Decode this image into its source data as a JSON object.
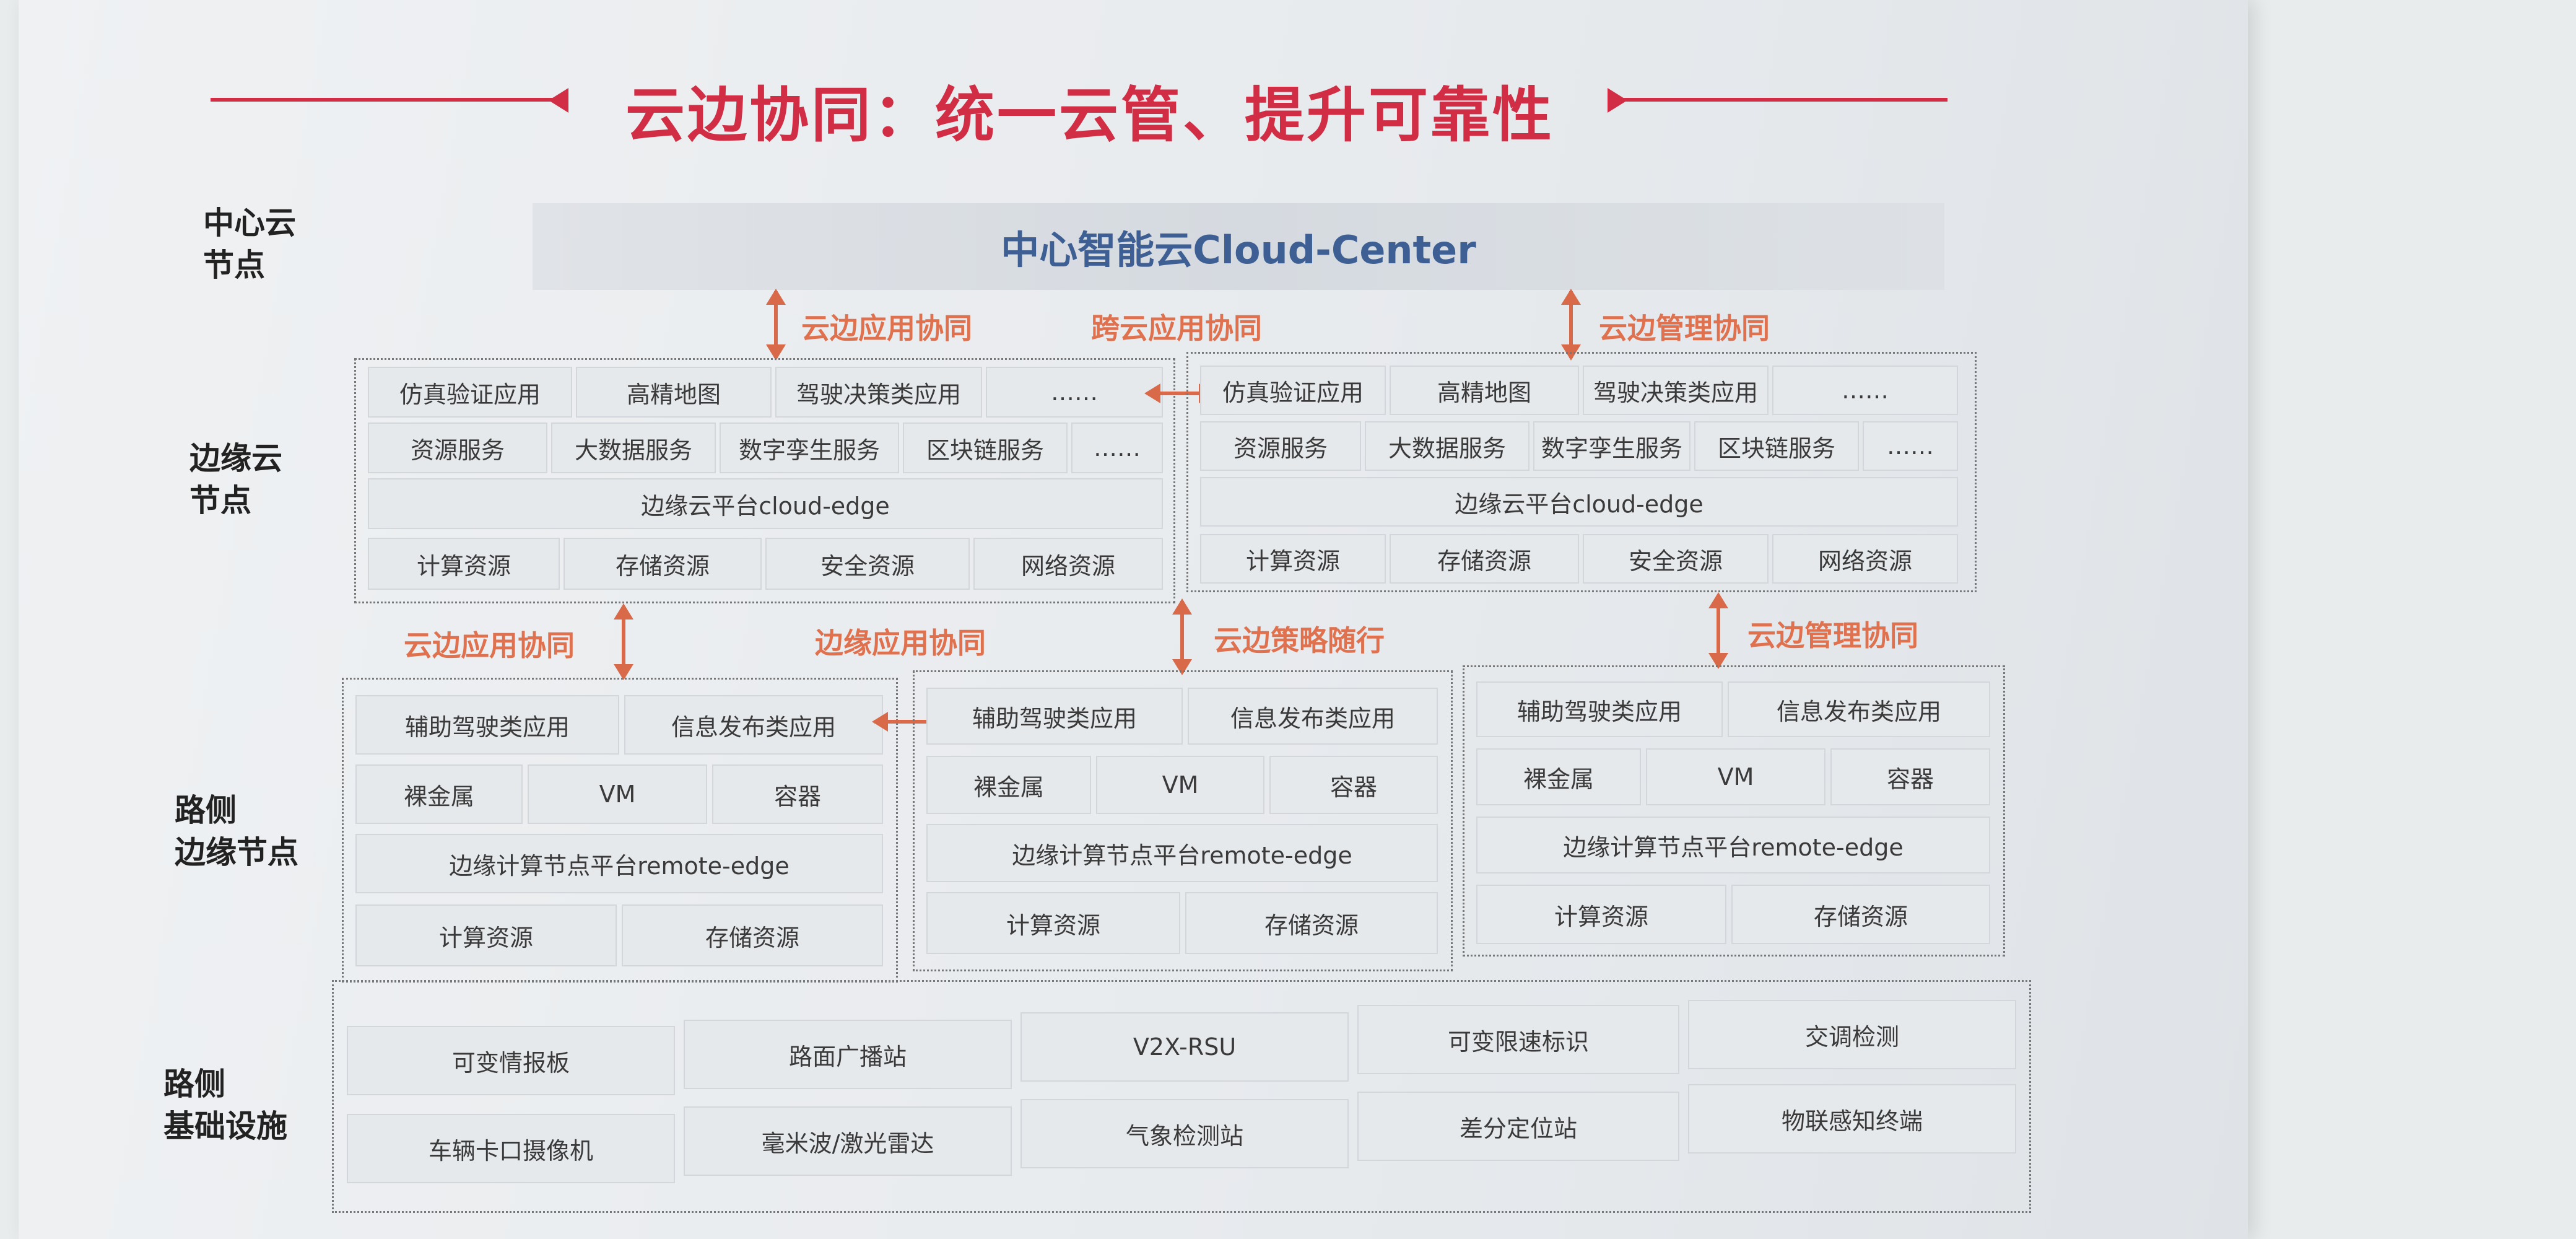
{
  "title": "云边协同：统一云管、提升可靠性",
  "labels": {
    "center": [
      "中心云",
      "节点"
    ],
    "edge_cloud": [
      "边缘云",
      "节点"
    ],
    "roadside_edge": [
      "路侧",
      "边缘节点"
    ],
    "roadside_infra": [
      "路侧",
      "基础设施"
    ]
  },
  "center_cloud": "中心智能云Cloud-Center",
  "arrow_labels": {
    "top_left": "云边应用协同",
    "top_mid": "跨云应用协同",
    "top_right": "云边管理协同",
    "mid_left": "云边应用协同",
    "mid_center": "边缘应用协同",
    "mid_mid": "云边策略随行",
    "mid_right": "云边管理协同"
  },
  "edge_cloud": {
    "apps": [
      "仿真验证应用",
      "高精地图",
      "驾驶决策类应用",
      "……"
    ],
    "services": [
      "资源服务",
      "大数据服务",
      "数字孪生服务",
      "区块链服务",
      "……"
    ],
    "platform": "边缘云平台cloud-edge",
    "resources": [
      "计算资源",
      "存储资源",
      "安全资源",
      "网络资源"
    ]
  },
  "roadside_edge": {
    "apps": [
      "辅助驾驶类应用",
      "信息发布类应用"
    ],
    "runtime": [
      "裸金属",
      "VM",
      "容器"
    ],
    "platform": "边缘计算节点平台remote-edge",
    "resources": [
      "计算资源",
      "存储资源"
    ]
  },
  "infra": {
    "row1": [
      "可变情报板",
      "路面广播站",
      "V2X-RSU",
      "可变限速标识",
      "交调检测"
    ],
    "row2": [
      "车辆卡口摄像机",
      "毫米波/激光雷达",
      "气象检测站",
      "差分定位站",
      "物联感知终端"
    ]
  },
  "colors": {
    "title": "#d12e46",
    "arrow": "#d86a4a",
    "center_text": "#3e5f94"
  }
}
